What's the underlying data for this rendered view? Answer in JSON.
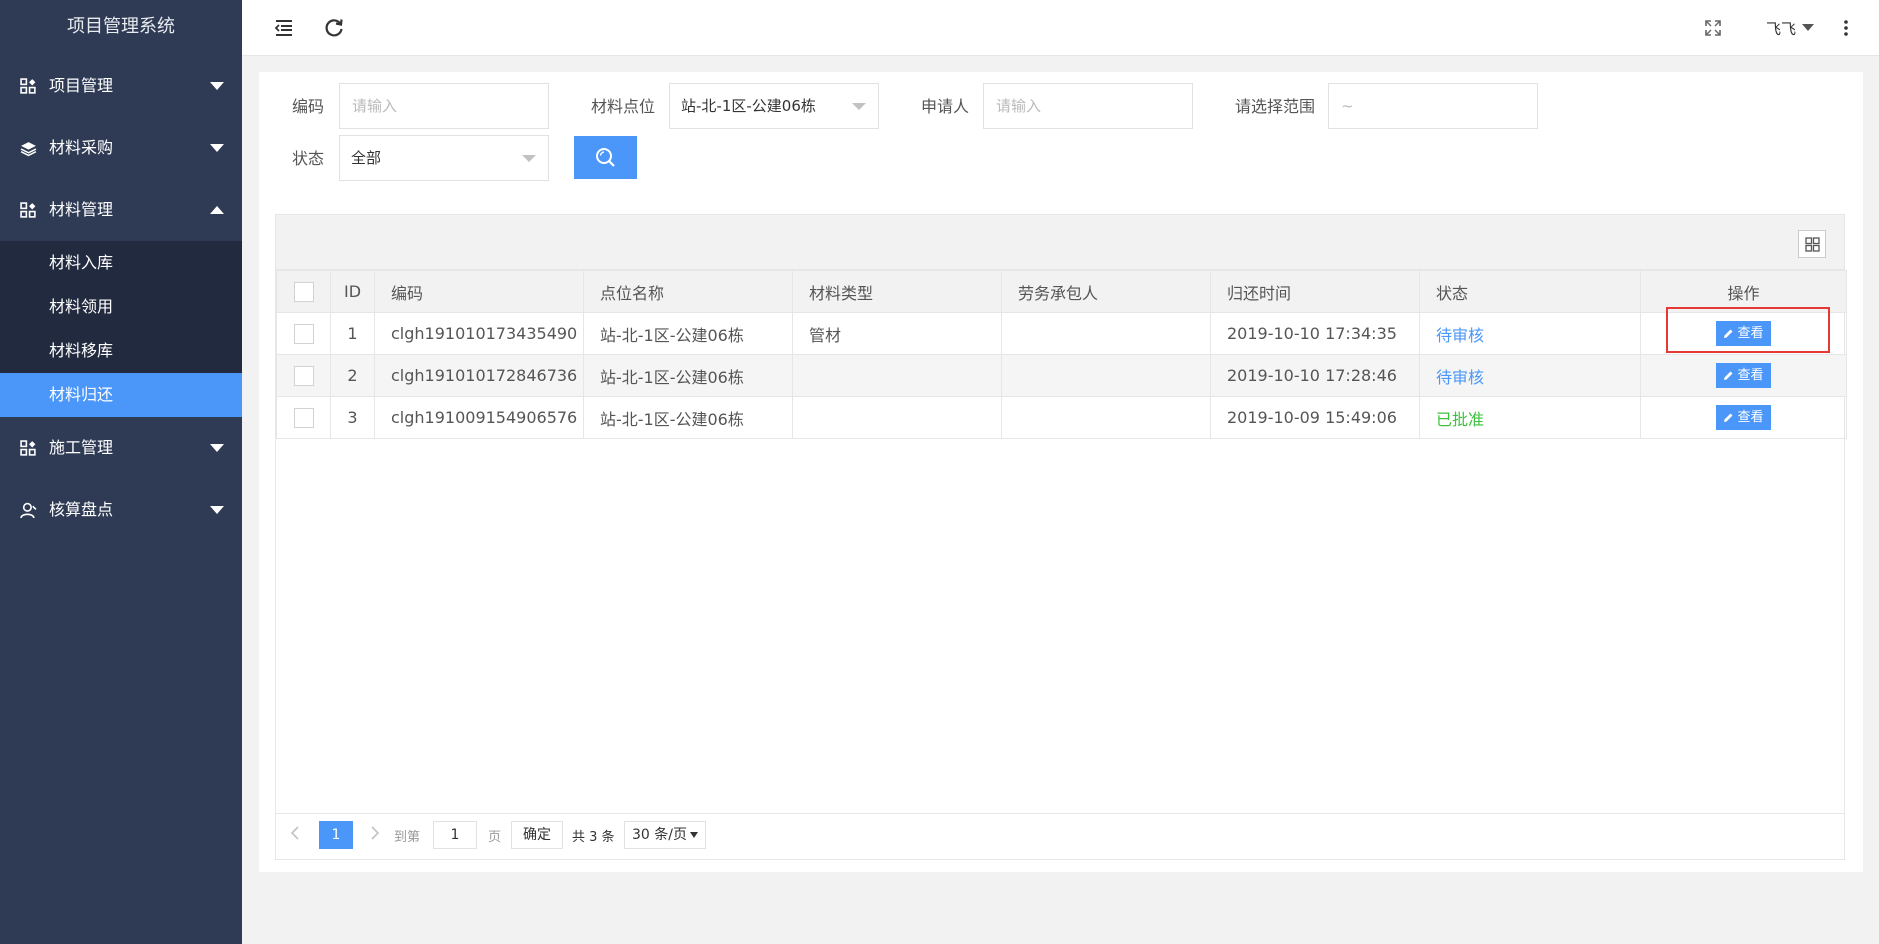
{
  "app": {
    "title": "项目管理系统"
  },
  "sidebar": {
    "items": [
      {
        "label": "项目管理",
        "icon": "grid-icon",
        "expanded": false
      },
      {
        "label": "材料采购",
        "icon": "layers-icon",
        "expanded": false
      },
      {
        "label": "材料管理",
        "icon": "grid-icon",
        "expanded": true,
        "children": [
          {
            "label": "材料入库",
            "active": false
          },
          {
            "label": "材料领用",
            "active": false
          },
          {
            "label": "材料移库",
            "active": false
          },
          {
            "label": "材料归还",
            "active": true
          }
        ]
      },
      {
        "label": "施工管理",
        "icon": "grid-icon",
        "expanded": false
      },
      {
        "label": "核算盘点",
        "icon": "user-icon",
        "expanded": false
      }
    ]
  },
  "topbar": {
    "user": "飞飞",
    "icons": [
      "menu-fold-icon",
      "refresh-icon",
      "fullscreen-icon",
      "more-icon"
    ]
  },
  "filters": {
    "code_label": "编码",
    "code_placeholder": "请输入",
    "site_label": "材料点位",
    "site_value": "站-北-1区-公建06栋",
    "applicant_label": "申请人",
    "applicant_placeholder": "请输入",
    "range_label": "请选择范围",
    "range_placeholder": "~",
    "status_label": "状态",
    "status_value": "全部"
  },
  "table": {
    "headers": {
      "id": "ID",
      "code": "编码",
      "site": "点位名称",
      "material_type": "材料类型",
      "contractor": "劳务承包人",
      "return_time": "归还时间",
      "status": "状态",
      "action": "操作"
    },
    "rows": [
      {
        "id": "1",
        "code": "clgh191010173435490",
        "site": "站-北-1区-公建06栋",
        "material_type": "管材",
        "contractor": "",
        "return_time": "2019-10-10 17:34:35",
        "status": "待审核",
        "action": "查看"
      },
      {
        "id": "2",
        "code": "clgh191010172846736",
        "site": "站-北-1区-公建06栋",
        "material_type": "",
        "contractor": "",
        "return_time": "2019-10-10 17:28:46",
        "status": "待审核",
        "action": "查看"
      },
      {
        "id": "3",
        "code": "clgh191009154906576",
        "site": "站-北-1区-公建06栋",
        "material_type": "",
        "contractor": "",
        "return_time": "2019-10-09 15:49:06",
        "status": "已批准",
        "action": "查看"
      }
    ]
  },
  "pagination": {
    "current_page": "1",
    "goto_label": "到第",
    "goto_value": "1",
    "page_unit": "页",
    "confirm": "确定",
    "total": "共 3 条",
    "page_size": "30 条/页"
  },
  "colors": {
    "sidebar_bg": "#2f3b55",
    "submenu_bg": "#212a3e",
    "accent": "#4b97f9",
    "pending": "#4b97f9",
    "approved": "#3ec23e",
    "highlight": "#e53935"
  }
}
